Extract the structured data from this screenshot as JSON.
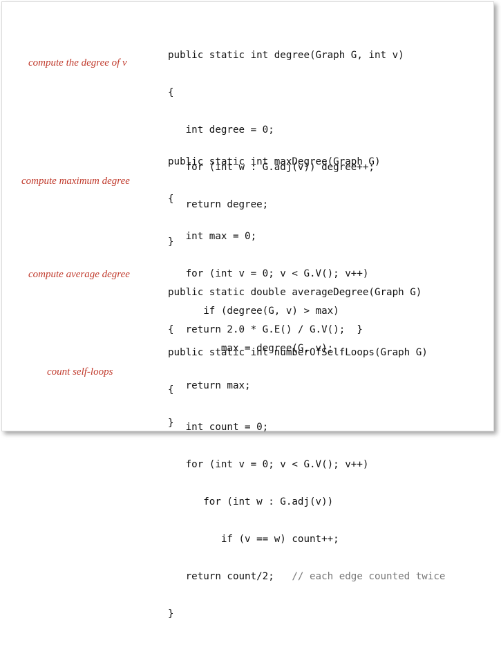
{
  "annotations": {
    "degree": "compute the degree of v",
    "max_degree": "compute maximum degree",
    "average_degree": "compute average degree",
    "self_loops": "count self-loops"
  },
  "code": {
    "degree": [
      "public static int degree(Graph G, int v)",
      "{",
      "   int degree = 0;",
      "   for (int w : G.adj(v)) degree++;",
      "   return degree;",
      "}"
    ],
    "max_degree": [
      "public static int maxDegree(Graph G)",
      "{",
      "   int max = 0;",
      "   for (int v = 0; v < G.V(); v++)",
      "      if (degree(G, v) > max)",
      "         max = degree(G, v);",
      "   return max;",
      "}"
    ],
    "average_degree": [
      "public static double averageDegree(Graph G)",
      "{  return 2.0 * G.E() / G.V();  }"
    ],
    "self_loops": [
      "public static int numberOfSelfLoops(Graph G)",
      "{",
      "   int count = 0;",
      "   for (int v = 0; v < G.V(); v++)",
      "      for (int w : G.adj(v))",
      "         if (v == w) count++;",
      "   return count/2;   ",
      "}"
    ],
    "self_loops_comment": "// each edge counted twice"
  }
}
